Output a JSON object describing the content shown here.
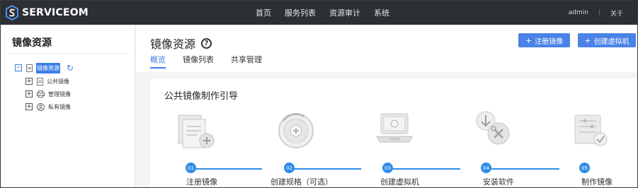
{
  "app": {
    "logo_text": "SERVICEOM"
  },
  "nav": {
    "items": [
      {
        "label": "首页"
      },
      {
        "label": "服务列表"
      },
      {
        "label": "资源审计"
      },
      {
        "label": "系统"
      }
    ]
  },
  "user": {
    "name": "admin",
    "about": "关于"
  },
  "sidebar": {
    "title": "镜像资源",
    "root": {
      "label": "镜像资源",
      "icon": "document-icon"
    },
    "children": [
      {
        "label": "公共镜像",
        "icon": "document-icon"
      },
      {
        "label": "管理镜像",
        "icon": "printer-icon"
      },
      {
        "label": "私有镜像",
        "icon": "user-icon"
      }
    ]
  },
  "page": {
    "title": "镜像资源",
    "buttons": {
      "register": "注册镜像",
      "create_vm": "创建虚拟机"
    },
    "tabs": [
      {
        "label": "概览",
        "active": true
      },
      {
        "label": "镜像列表",
        "active": false
      },
      {
        "label": "共享管理",
        "active": false
      }
    ]
  },
  "guide": {
    "title": "公共镜像制作引导",
    "steps": [
      {
        "num": "01",
        "label": "注册镜像",
        "icon": "document-stack-icon"
      },
      {
        "num": "02",
        "label": "创建规格（可选）",
        "icon": "disc-plus-icon"
      },
      {
        "num": "03",
        "label": "创建虚拟机",
        "icon": "laptop-icon"
      },
      {
        "num": "04",
        "label": "安装软件",
        "icon": "install-tools-icon"
      },
      {
        "num": "05",
        "label": "制作镜像",
        "icon": "device-check-icon"
      }
    ]
  },
  "colors": {
    "accent": "#3d7fe6",
    "topbar": "#2c2f33",
    "step_blue": "#2f8be6"
  }
}
